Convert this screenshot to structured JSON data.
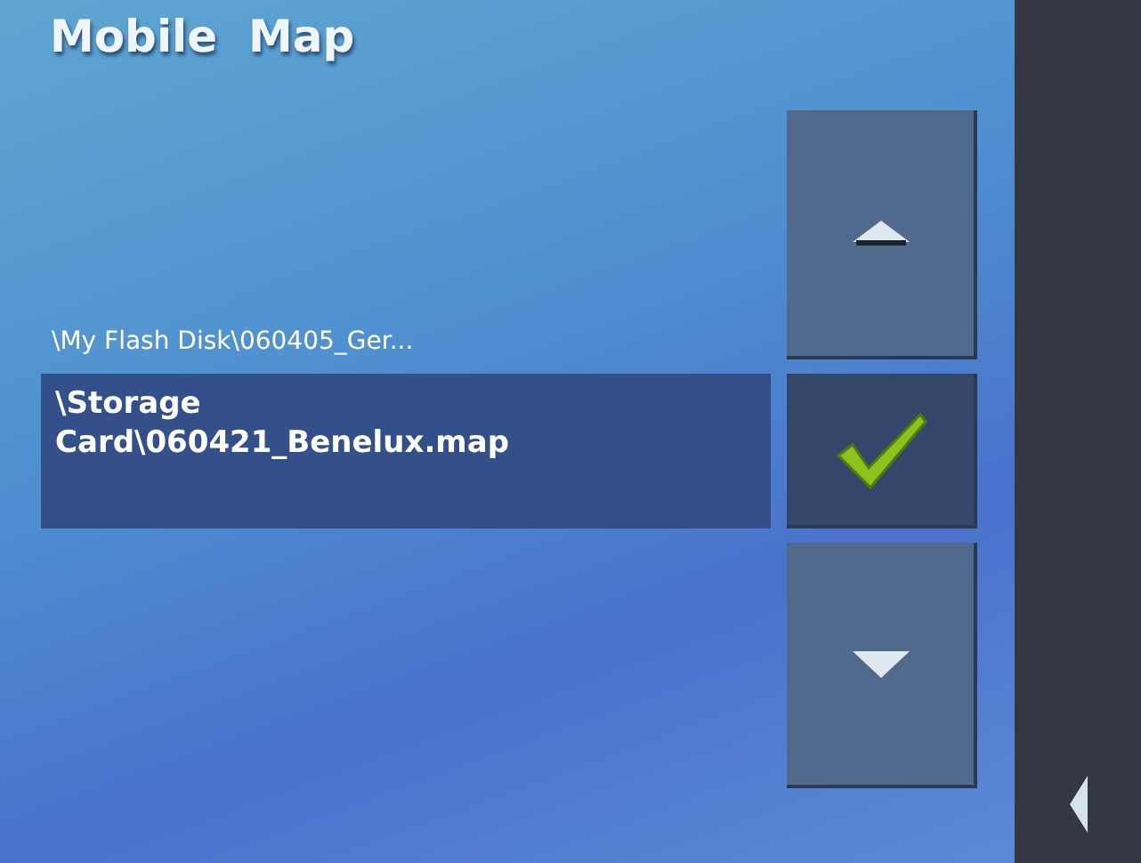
{
  "title": "Mobile  Map",
  "files": [
    {
      "label": "\\My Flash Disk\\060405_Ger...",
      "selected": false
    },
    {
      "label": "\\Storage Card\\060421_Benelux.map",
      "selected": true
    }
  ],
  "buttons": [
    {
      "kind": "up"
    },
    {
      "kind": "confirm"
    },
    {
      "kind": "down"
    }
  ]
}
